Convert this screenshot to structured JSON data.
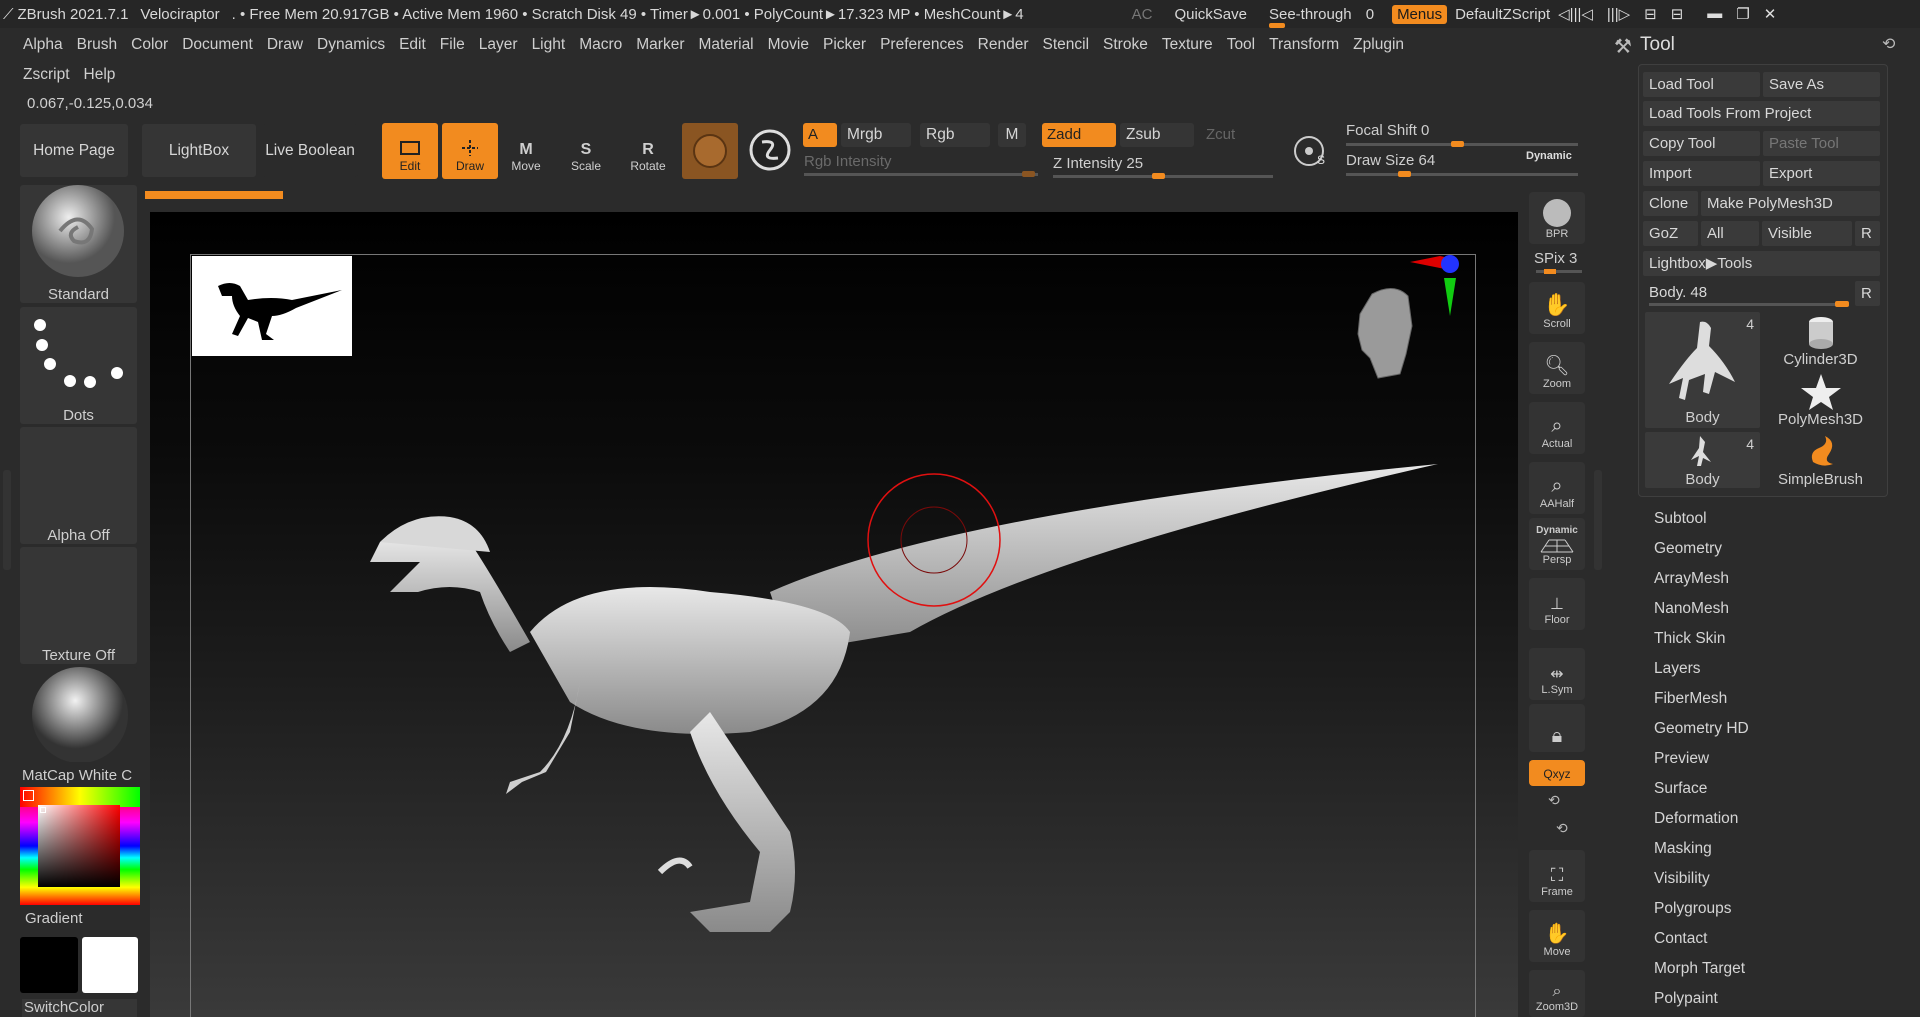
{
  "titlebar": {
    "app": "ZBrush 2021.7.1",
    "doc": "Velociraptor",
    "stats": ". • Free Mem 20.917GB • Active Mem 1960 • Scratch Disk 49 • Timer►0.001 • PolyCount►17.323 MP • MeshCount►4",
    "ac": "AC",
    "quicksave": "QuickSave",
    "seethrough": "See-through",
    "seethrough_val": "0",
    "menus": "Menus",
    "script": "DefaultZScript"
  },
  "menubar": [
    "Alpha",
    "Brush",
    "Color",
    "Document",
    "Draw",
    "Dynamics",
    "Edit",
    "File",
    "Layer",
    "Light",
    "Macro",
    "Marker",
    "Material",
    "Movie",
    "Picker",
    "Preferences",
    "Render",
    "Stencil",
    "Stroke",
    "Texture",
    "Tool",
    "Transform",
    "Zplugin"
  ],
  "menubar2": [
    "Zscript",
    "Help"
  ],
  "coords": "0.067,-0.125,0.034",
  "shelf": {
    "home": "Home Page",
    "lightbox": "LightBox",
    "liveboolean": "Live Boolean",
    "edit": "Edit",
    "draw": "Draw",
    "move": "Move",
    "scale": "Scale",
    "rotate": "Rotate",
    "a": "A",
    "mrgb": "Mrgb",
    "rgb": "Rgb",
    "m": "M",
    "zadd": "Zadd",
    "zsub": "Zsub",
    "zcut": "Zcut",
    "rgb_intensity": "Rgb Intensity",
    "z_intensity": "Z Intensity 25",
    "focal_shift": "Focal Shift 0",
    "draw_size": "Draw Size 64",
    "dynamic": "Dynamic"
  },
  "left": {
    "brush": "Standard",
    "stroke": "Dots",
    "alpha": "Alpha Off",
    "texture": "Texture Off",
    "material": "MatCap White C",
    "gradient": "Gradient",
    "switchcolor": "SwitchColor"
  },
  "right_tools": {
    "bpr": "BPR",
    "spix": "SPix 3",
    "scroll": "Scroll",
    "zoom": "Zoom",
    "actual": "Actual",
    "aahalf": "AAHalf",
    "dynamic": "Dynamic",
    "persp": "Persp",
    "floor": "Floor",
    "lsym": "L.Sym",
    "xyz": "Qxyz",
    "frame": "Frame",
    "move": "Move",
    "zoom3d": "Zoom3D"
  },
  "toolpanel": {
    "title": "Tool",
    "load_tool": "Load Tool",
    "save_as": "Save As",
    "load_from_project": "Load Tools From Project",
    "copy_tool": "Copy Tool",
    "paste_tool": "Paste Tool",
    "import": "Import",
    "export": "Export",
    "clone": "Clone",
    "make_polymesh": "Make PolyMesh3D",
    "goz": "GoZ",
    "all": "All",
    "visible": "Visible",
    "r": "R",
    "lightbox_tools": "Lightbox▶Tools",
    "body_slider": "Body. 48",
    "thumbs": [
      {
        "label": "Body",
        "count": "4"
      },
      {
        "label": "Cylinder3D",
        "count": ""
      },
      {
        "label": "PolyMesh3D",
        "count": ""
      },
      {
        "label": "Body",
        "count": "4"
      },
      {
        "label": "SimpleBrush",
        "count": ""
      }
    ],
    "subpalettes": [
      "Subtool",
      "Geometry",
      "ArrayMesh",
      "NanoMesh",
      "Thick Skin",
      "Layers",
      "FiberMesh",
      "Geometry HD",
      "Preview",
      "Surface",
      "Deformation",
      "Masking",
      "Visibility",
      "Polygroups",
      "Contact",
      "Morph Target",
      "Polypaint"
    ]
  }
}
